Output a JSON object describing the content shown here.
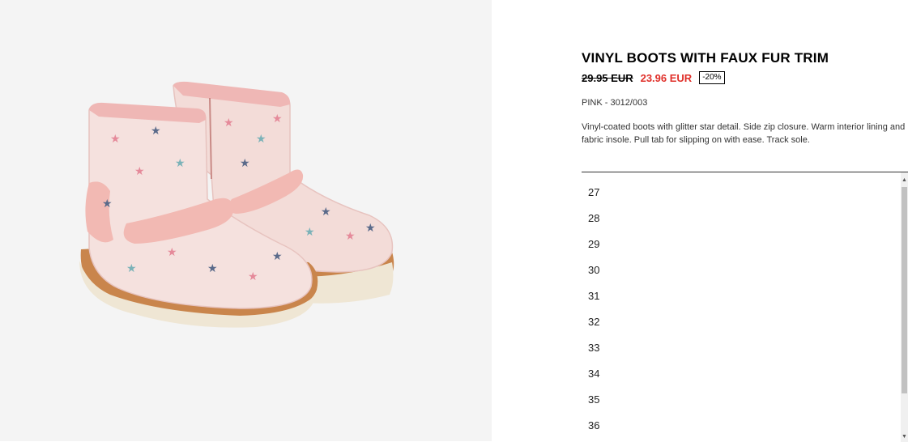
{
  "product": {
    "title": "VINYL BOOTS WITH FAUX FUR TRIM",
    "old_price": "29.95 EUR",
    "new_price": "23.96 EUR",
    "discount": "-20%",
    "color_ref": "PINK - 3012/003",
    "description": "Vinyl-coated boots with glitter star detail. Side zip closure. Warm interior lining and fabric insole. Pull tab for slipping on with ease. Track sole."
  },
  "sizes": [
    "27",
    "28",
    "29",
    "30",
    "31",
    "32",
    "33",
    "34",
    "35",
    "36"
  ],
  "colors": {
    "sale_red": "#e0302a",
    "image_bg": "#f4f4f4"
  }
}
